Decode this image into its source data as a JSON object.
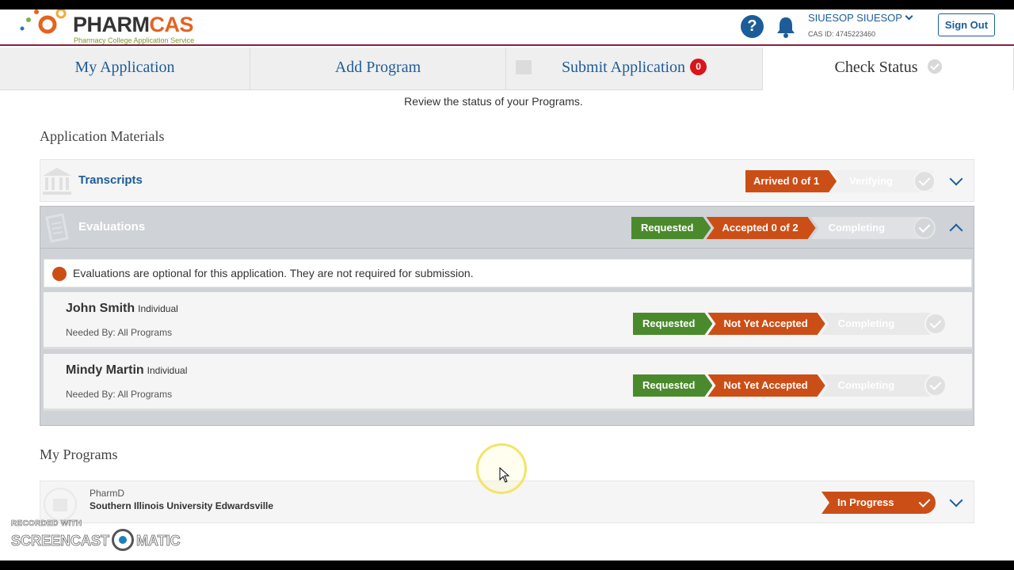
{
  "header": {
    "logo_text": "PHARMCAS",
    "logo_tagline": "Pharmacy College Application Service",
    "user_name": "SIUESOP SIUESOP",
    "cas_id": "CAS ID: 4745223460",
    "sign_out_label": "Sign Out",
    "help_glyph": "?"
  },
  "tabs": [
    {
      "label": "My Application"
    },
    {
      "label": "Add Program"
    },
    {
      "label": "Submit Application",
      "badge": "0"
    },
    {
      "label": "Check Status"
    }
  ],
  "subtitle": "Review the status of your Programs.",
  "materials": {
    "title": "Application Materials",
    "transcripts": {
      "label": "Transcripts",
      "status1": "Arrived 0 of 1",
      "status2": "Verifying"
    },
    "evaluations": {
      "label": "Evaluations",
      "status1": "Requested",
      "status2": "Accepted 0 of 2",
      "status3": "Completing",
      "notice": "Evaluations are optional for this application. They are not required for submission.",
      "evaluators": [
        {
          "name": "John Smith",
          "type": "Individual",
          "needed_by": "Needed By: All Programs",
          "status1": "Requested",
          "status2": "Not Yet Accepted",
          "status3": "Completing"
        },
        {
          "name": "Mindy Martin",
          "type": "Individual",
          "needed_by": "Needed By: All Programs",
          "status1": "Requested",
          "status2": "Not Yet Accepted",
          "status3": "Completing"
        }
      ]
    }
  },
  "programs": {
    "title": "My Programs",
    "items": [
      {
        "type": "PharmD",
        "name": "Southern Illinois University Edwardsville",
        "status": "In Progress"
      }
    ]
  },
  "watermark": {
    "small": "RECORDED WITH",
    "left": "SCREENCAST",
    "right": "MATIC"
  },
  "colors": {
    "brand_blue": "#1c5d99",
    "requested_green": "#4a8a2c",
    "status_orange": "#cc4e17",
    "badge_red": "#d9141a",
    "header_rule": "#8a1d3d"
  }
}
